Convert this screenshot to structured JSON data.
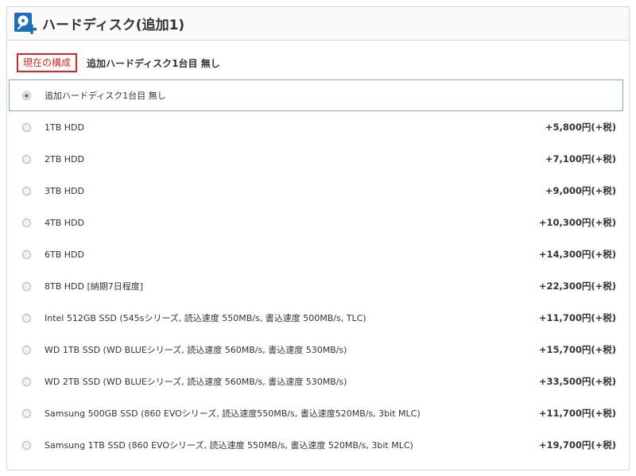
{
  "header": {
    "title": "ハードディスク(追加1)",
    "icon": "hdd-add-icon",
    "icon_color": "#1e6fb7"
  },
  "current": {
    "badge": "現在の構成",
    "value": "追加ハードディスク1台目 無し",
    "badge_color": "#d9252a"
  },
  "options": [
    {
      "label": "追加ハードディスク1台目 無し",
      "price": "",
      "selected": true
    },
    {
      "label": "1TB HDD",
      "price": "+5,800円(+税)",
      "selected": false
    },
    {
      "label": "2TB HDD",
      "price": "+7,100円(+税)",
      "selected": false
    },
    {
      "label": "3TB HDD",
      "price": "+9,000円(+税)",
      "selected": false
    },
    {
      "label": "4TB HDD",
      "price": "+10,300円(+税)",
      "selected": false
    },
    {
      "label": "6TB HDD",
      "price": "+14,300円(+税)",
      "selected": false
    },
    {
      "label": "8TB HDD [納期7日程度]",
      "price": "+22,300円(+税)",
      "selected": false
    },
    {
      "label": "Intel 512GB SSD (545sシリーズ, 読込速度 550MB/s, 書込速度 500MB/s, TLC)",
      "price": "+11,700円(+税)",
      "selected": false
    },
    {
      "label": "WD 1TB SSD (WD BLUEシリーズ, 読込速度 560MB/s, 書込速度 530MB/s)",
      "price": "+15,700円(+税)",
      "selected": false
    },
    {
      "label": "WD 2TB SSD (WD BLUEシリーズ, 読込速度 560MB/s, 書込速度 530MB/s)",
      "price": "+33,500円(+税)",
      "selected": false
    },
    {
      "label": "Samsung 500GB SSD (860 EVOシリーズ, 読込速度550MB/s, 書込速度520MB/s, 3bit MLC)",
      "price": "+11,700円(+税)",
      "selected": false
    },
    {
      "label": "Samsung 1TB SSD (860 EVOシリーズ, 読込速度 550MB/s, 書込速度 520MB/s, 3bit MLC)",
      "price": "+19,700円(+税)",
      "selected": false
    }
  ]
}
